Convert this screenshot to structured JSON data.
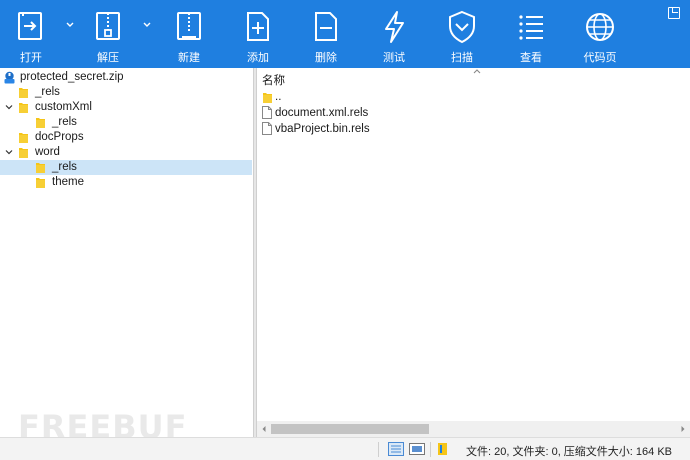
{
  "toolbar": {
    "buttons": [
      {
        "label": "打开",
        "icon": "open-icon"
      },
      {
        "label": "解压",
        "icon": "extract-icon"
      },
      {
        "label": "新建",
        "icon": "new-archive-icon"
      },
      {
        "label": "添加",
        "icon": "add-icon"
      },
      {
        "label": "删除",
        "icon": "delete-icon"
      },
      {
        "label": "测试",
        "icon": "test-icon"
      },
      {
        "label": "扫描",
        "icon": "scan-shield-icon"
      },
      {
        "label": "查看",
        "icon": "view-list-icon"
      },
      {
        "label": "代码页",
        "icon": "globe-icon"
      }
    ],
    "accent": "#1f7fe0"
  },
  "tree": {
    "root": "protected_secret.zip",
    "items": [
      {
        "label": "_rels",
        "expanded": null
      },
      {
        "label": "customXml",
        "expanded": true
      },
      {
        "label": "_rels",
        "expanded": null
      },
      {
        "label": "docProps",
        "expanded": null
      },
      {
        "label": "word",
        "expanded": true
      },
      {
        "label": "_rels",
        "expanded": null,
        "selected": true
      },
      {
        "label": "theme",
        "expanded": null
      }
    ]
  },
  "files": {
    "column_header": "名称",
    "rows": [
      {
        "name": "..",
        "type": "folder"
      },
      {
        "name": "document.xml.rels",
        "type": "file"
      },
      {
        "name": "vbaProject.bin.rels",
        "type": "file"
      }
    ]
  },
  "status": {
    "summary": "文件: 20, 文件夹: 0, 压缩文件大小: 164 KB"
  },
  "watermark": {
    "text": "FREEBUF"
  },
  "colors": {
    "folder": "#f5c518",
    "selection": "#cce4f7"
  }
}
